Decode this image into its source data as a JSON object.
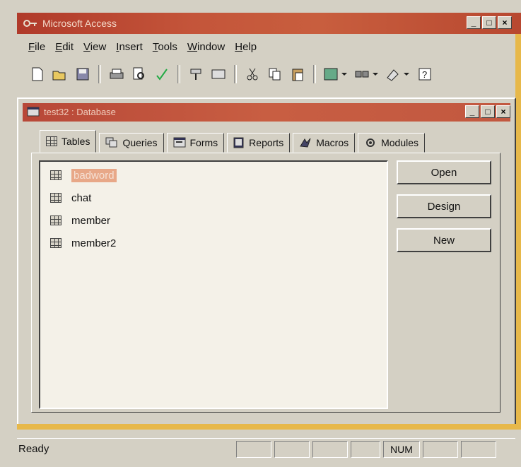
{
  "app": {
    "title": "Microsoft Access",
    "window_buttons": [
      "_",
      "□",
      "×"
    ]
  },
  "menu": {
    "items": [
      {
        "label": "File",
        "key": "F"
      },
      {
        "label": "Edit",
        "key": "E"
      },
      {
        "label": "View",
        "key": "V"
      },
      {
        "label": "Insert",
        "key": "I"
      },
      {
        "label": "Tools",
        "key": "T"
      },
      {
        "label": "Window",
        "key": "W"
      },
      {
        "label": "Help",
        "key": "H"
      }
    ]
  },
  "toolbar": {
    "icons": [
      "new-icon",
      "open-icon",
      "save-icon",
      "print-icon",
      "print-preview-icon",
      "spelling-icon",
      "format-painter-icon",
      "undo-icon",
      "cut-icon",
      "copy-icon",
      "paste-icon",
      "office-links-icon",
      "analyze-icon",
      "new-object-icon",
      "help-icon"
    ]
  },
  "database_window": {
    "title": "test32 : Database",
    "tabs": [
      "Tables",
      "Queries",
      "Forms",
      "Reports",
      "Macros",
      "Modules"
    ],
    "active_tab": "Tables",
    "items": [
      "badword",
      "chat",
      "member",
      "member2"
    ],
    "selected_item": "badword",
    "buttons": {
      "open": "Open",
      "design": "Design",
      "new": "New"
    }
  },
  "status": {
    "text": "Ready",
    "num": "NUM"
  },
  "colors": {
    "titlebar": "#c4553a",
    "selection": "#e8a888",
    "face": "#d4d0c4"
  }
}
